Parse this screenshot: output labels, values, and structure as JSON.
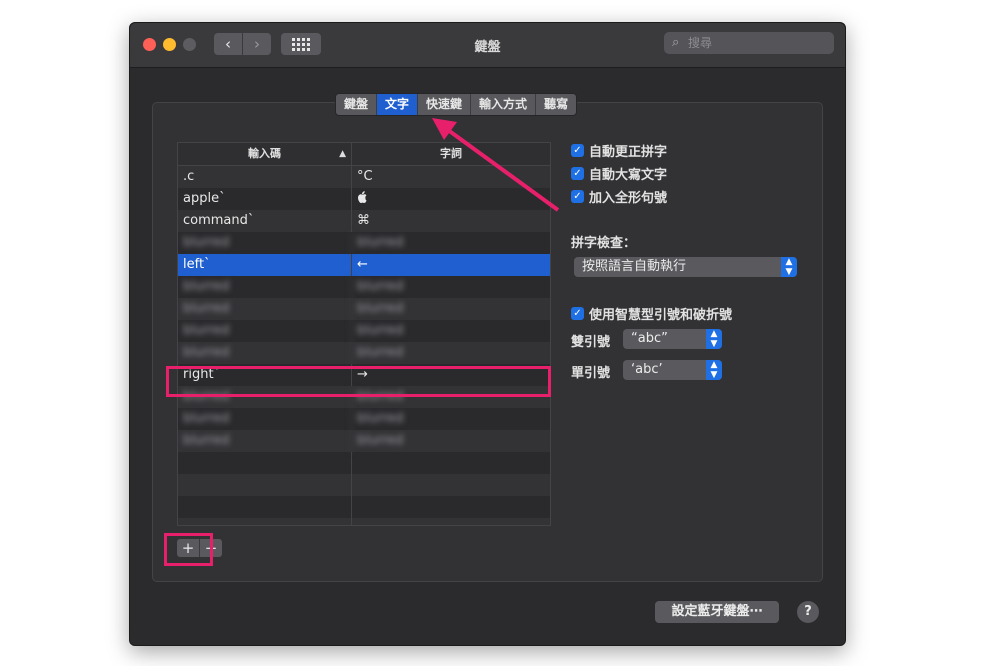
{
  "window": {
    "title": "鍵盤"
  },
  "search": {
    "placeholder": "搜尋"
  },
  "nav": {
    "back": "‹",
    "forward": "›"
  },
  "tabs": [
    {
      "label": "鍵盤",
      "active": false
    },
    {
      "label": "文字",
      "active": true
    },
    {
      "label": "快速鍵",
      "active": false
    },
    {
      "label": "輸入方式",
      "active": false
    },
    {
      "label": "聽寫",
      "active": false
    }
  ],
  "table": {
    "headers": [
      "輸入碼",
      "字詞"
    ],
    "rows": [
      {
        "input": ".c",
        "word": "°C"
      },
      {
        "input": "apple`",
        "word": ""
      },
      {
        "input": "command`",
        "word": "⌘"
      },
      {
        "input": "blurred",
        "word": "blurred"
      },
      {
        "input": "left`",
        "word": "←"
      },
      {
        "input": "blurred",
        "word": "blurred"
      },
      {
        "input": "blurred",
        "word": "blurred"
      },
      {
        "input": "blurred",
        "word": "blurred"
      },
      {
        "input": "blurred",
        "word": "blurred"
      },
      {
        "input": "right`",
        "word": "→"
      },
      {
        "input": "blurred",
        "word": "blurred"
      },
      {
        "input": "blurred",
        "word": "blurred"
      },
      {
        "input": "blurred",
        "word": "blurred"
      }
    ]
  },
  "buttons": {
    "add": "+",
    "remove": "−",
    "bluetooth": "設定藍牙鍵盤⋯",
    "help": "?"
  },
  "options": {
    "auto_correct": "自動更正拼字",
    "auto_capitalize": "自動大寫文字",
    "full_width_period": "加入全形句號",
    "spellcheck_label": "拼字檢查：",
    "spellcheck_value": "按照語言自動執行",
    "smart_quotes": "使用智慧型引號和破折號",
    "double_quote_label": "雙引號",
    "double_quote_value": "“abc”",
    "single_quote_label": "單引號",
    "single_quote_value": "‘abc’"
  },
  "colors": {
    "accent": "#1f5fcf",
    "highlight": "#e8206b"
  }
}
